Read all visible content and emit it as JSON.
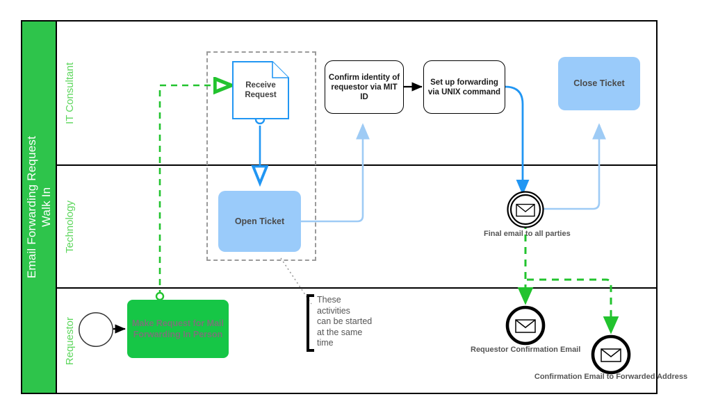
{
  "pool": {
    "title": "Email Forwarding Request\nWalk In",
    "header_color": "#2ec44b",
    "lanes": [
      {
        "id": "it",
        "label": "IT Consultant"
      },
      {
        "id": "tech",
        "label": "Technology"
      },
      {
        "id": "req",
        "label": "Requestor"
      }
    ]
  },
  "colors": {
    "green": "#2ec44b",
    "green_task": "#16c646",
    "green_flow": "#22c32e",
    "light_blue": "#9acbfa",
    "blue_flow": "#2196f3",
    "pale_blue_flow": "#9ecbf5",
    "lane_label": "#5cd65c",
    "group_border": "#9a9a9a",
    "black": "#000000"
  },
  "nodes": {
    "receive_request": {
      "label": "Receive\nRequest",
      "type": "document"
    },
    "confirm_identity": {
      "label": "Confirm identity of\nrequestor via MIT ID",
      "type": "task"
    },
    "setup_forwarding": {
      "label": "Set up forwarding via\nUNIX command",
      "type": "task"
    },
    "close_ticket": {
      "label": "Close Ticket",
      "type": "task-blue"
    },
    "open_ticket": {
      "label": "Open Ticket",
      "type": "task-blue"
    },
    "make_request": {
      "label": "Make Request for Mail\nForwarding In Person",
      "type": "task-green"
    },
    "start_event": {
      "label": "",
      "type": "start-event"
    },
    "final_email": {
      "label": "Final email to all parties",
      "type": "intermediate-message-event"
    },
    "requestor_confirmation_email": {
      "label": "Requestor Confirmation Email",
      "type": "end-message-event"
    },
    "confirmation_email_forwarded": {
      "label": "Confirmation Email to Forwarded Address",
      "type": "end-message-event"
    }
  },
  "annotation": {
    "text": "These\nactivities\ncan be started\nat the same\ntime"
  }
}
